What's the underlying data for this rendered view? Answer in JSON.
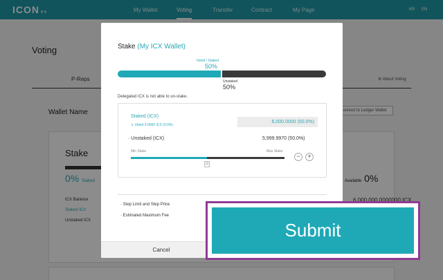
{
  "header": {
    "logo": "ICON",
    "logo_suffix": "ex",
    "nav": [
      "My Wallet",
      "Voting",
      "Transfer",
      "Contract",
      "My Page"
    ],
    "lang": [
      "KR",
      "EN"
    ]
  },
  "page": {
    "title": "Voting",
    "tab": "P-Reps",
    "about_link": "About Voting",
    "wallet_name_label": "Wallet Name",
    "connect_ledger": "Connect to Ledger Wallet",
    "card": {
      "title": "Stake",
      "left_pct": "0%",
      "left_pct_label": "Staked",
      "right_pct": "0%",
      "right_pct_label": "Available",
      "rows": [
        "ICX Balance",
        "Staked ICX",
        "Unstaked ICX"
      ],
      "right_value": "6,000,000.0000000 ICX"
    }
  },
  "modal": {
    "title": "Stake",
    "title_accent": "(My ICX Wallet)",
    "voted_label": "Voted / Staked",
    "voted_pct": "50%",
    "voted_fraction": 0.5,
    "unstaked_label": "Unstaked",
    "unstaked_pct": "50%",
    "delegated_note": "Delegated ICX is not able to un-stake.",
    "staked_label": "Staked (ICX)",
    "voted_sub": "Voted 0.0000 ICX (0.0%)",
    "staked_value": "6,000.0000 (50.0%)",
    "unstaked_row_label": "Unstaked (ICX)",
    "unstaked_row_value": "5,999.9970 (50.0%)",
    "min_stake": "Min Stake",
    "max_stake": "Max Stake",
    "slider_handle": "|||",
    "minus": "−",
    "plus": "+",
    "step_limit": "Step Limit and Step Price",
    "max_fee": "Estimated Maximum Fee",
    "cancel": "Cancel",
    "submit": "Submit"
  },
  "colors": {
    "accent": "#1fa9b7",
    "dark": "#3a3a3a",
    "highlight_border": "#8f3a94"
  }
}
